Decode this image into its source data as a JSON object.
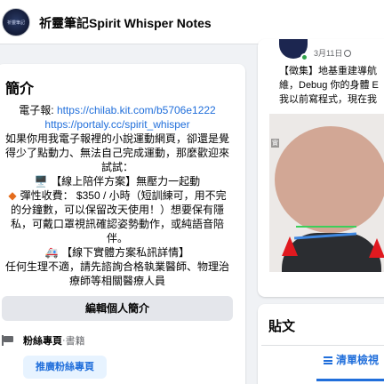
{
  "header": {
    "page_name": "祈靈筆記Spirit Whisper Notes",
    "avatar_text": "祈靈筆記"
  },
  "intro": {
    "title": "簡介",
    "bio": {
      "line1_prefix": "電子報: ",
      "link1": "https://chilab.kit.com/b5706e1222",
      "link2": "https://portaly.cc/spirit_whisper",
      "paragraph": "如果你用我電子報裡的小說運動網頁，卻還是覺得少了點動力、無法自己完成運動，那麼歡迎來試試：",
      "plan_online_icon": "🖥️",
      "plan_online": "【線上陪伴方案】無壓力一起動",
      "fee_icon": "◆",
      "fee": "彈性收費： $350 / 小時（短訓練可，用不完的分鐘數，可以保留改天使用！）想要保有隱私，可戴口罩視訊確認姿勢動作，或純語音陪伴。",
      "plan_offline_icon": "🚑",
      "plan_offline": "【線下實體方案私訊詳情】",
      "disclaimer": "任何生理不適，請先諮詢合格執業醫師、物理治療師等相關醫療人員"
    },
    "edit_button": "編輯個人簡介",
    "fan_page": {
      "name": "粉絲專頁",
      "separator": " · ",
      "category": "書籍"
    },
    "promote_button": "推廣粉絲專頁"
  },
  "post": {
    "date": "3月11日",
    "text_lines": [
      "【徵集】地基重建導航",
      "維，Debug 你的身體 E",
      "我以前寫程式，現在我"
    ],
    "image_badge": "實"
  },
  "posts_section": {
    "title": "貼文",
    "list_view": "清單檢視"
  },
  "colors": {
    "link": "#216fdb",
    "online": "#31a24c",
    "accent_red": "#e0191f"
  }
}
